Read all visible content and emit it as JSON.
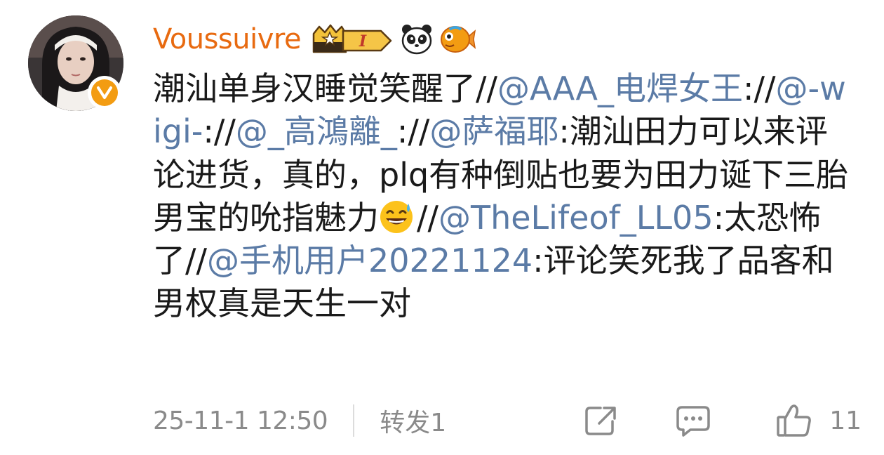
{
  "post": {
    "author": {
      "username": "Voussuivre",
      "avatar_icon": "avatar-nun-photo",
      "verified_icon": "verified-v-badge",
      "badges": [
        "crown-level-badge",
        "panda-badge",
        "fish-badge"
      ],
      "level_label": "I"
    },
    "content": {
      "t1": "潮汕单身汉睡觉笑醒了//",
      "m1": "@AAA_电焊女王",
      "t2": ":",
      "t3": "//",
      "m2": "@-wigi-",
      "t4": "://",
      "m3": "@_高鴻離_",
      "t5": "://",
      "m4": "@萨福耶",
      "t6": ":潮汕田力可以来评论进货，真的，plq有种倒贴也要为田力诞下三胎男宝的吮指魅力",
      "emoji": "sweat-smile-emoji",
      "t7": "//",
      "m5": "@TheLifeof_LL05",
      "t8": ":太恐怖了//",
      "m6": "@手机用户20221124",
      "t9": ":评论笑死我了品客和男权真是天生一对"
    },
    "footer": {
      "timestamp": "25-11-1 12:50",
      "repost_label": "转发1",
      "like_count": "11",
      "share_icon": "share-icon",
      "comment_icon": "comment-icon",
      "like_icon": "thumbs-up-icon"
    },
    "colors": {
      "username": "#e86a10",
      "mention": "#5b7ba6",
      "text": "#1a1a1a",
      "meta": "#8a8a8a",
      "verified": "#f39c12"
    }
  }
}
